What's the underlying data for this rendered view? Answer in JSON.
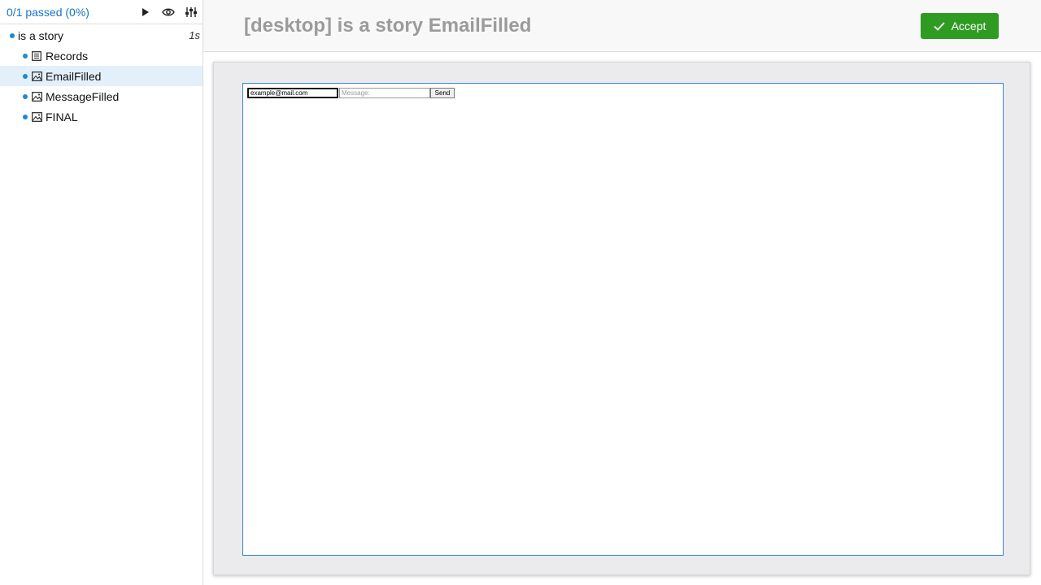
{
  "sidebar": {
    "summary": "0/1 passed (0%)",
    "toolbar_icons": [
      "play-icon",
      "eye-icon",
      "sliders-icon"
    ],
    "story": {
      "label": "is a story",
      "duration": "1s"
    },
    "items": [
      {
        "label": "Records",
        "icon": "list-icon"
      },
      {
        "label": "EmailFilled",
        "icon": "image-icon",
        "selected": true
      },
      {
        "label": "MessageFilled",
        "icon": "image-icon"
      },
      {
        "label": "FINAL",
        "icon": "image-icon"
      }
    ]
  },
  "header": {
    "title": "[desktop] is a story EmailFilled",
    "accept_label": "Accept"
  },
  "preview": {
    "email_value": "example@mail.com",
    "message_placeholder": "Message:",
    "send_label": "Send"
  },
  "colors": {
    "accent": "#1a73c8",
    "accept_green": "#2f9b22",
    "selected_bg": "#e3f0fb"
  }
}
